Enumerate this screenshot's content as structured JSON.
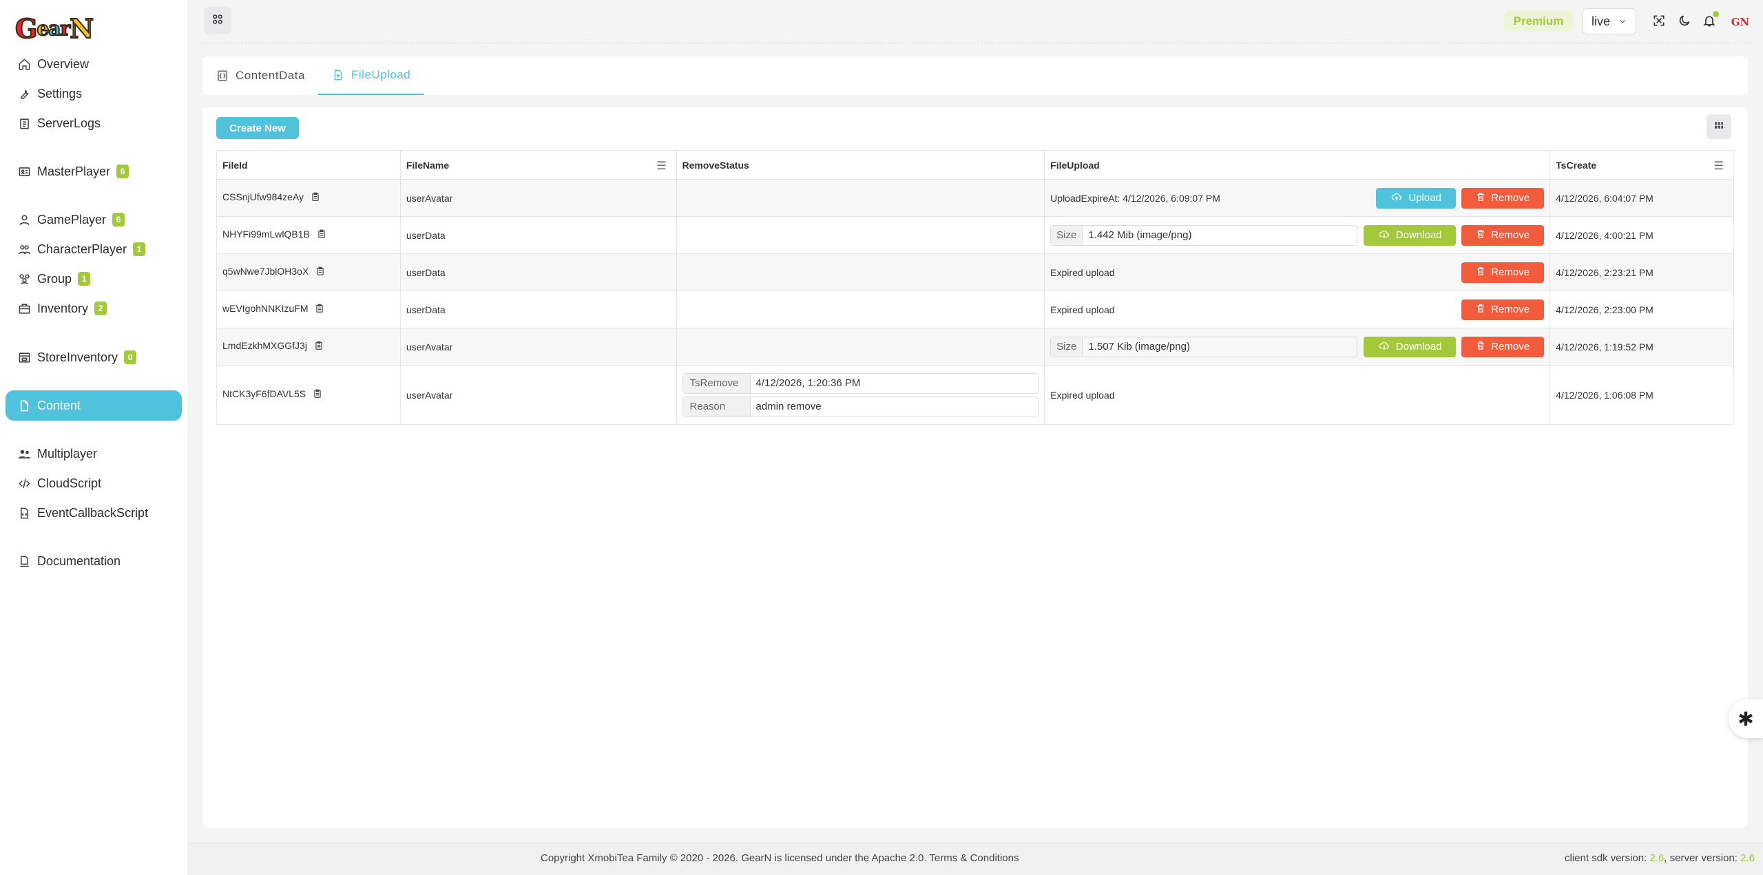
{
  "brand": {
    "logo_letters": [
      "G",
      "e",
      "a",
      "r",
      "N"
    ],
    "logo_colors": [
      "#e8232a",
      "#f7c21c",
      "#3dbde6",
      "#e8232a",
      "#f7c21c"
    ]
  },
  "sidebar": {
    "items": [
      {
        "label": "Overview",
        "icon": "home-icon"
      },
      {
        "label": "Settings",
        "icon": "wrench-icon"
      },
      {
        "label": "ServerLogs",
        "icon": "clipboard-icon"
      },
      {
        "label": "MasterPlayer",
        "icon": "id-card-icon",
        "badge": "6"
      },
      {
        "label": "GamePlayer",
        "icon": "user-icon",
        "badge": "6"
      },
      {
        "label": "CharacterPlayer",
        "icon": "users-icon",
        "badge": "1"
      },
      {
        "label": "Group",
        "icon": "group-icon",
        "badge": "1"
      },
      {
        "label": "Inventory",
        "icon": "briefcase-icon",
        "badge": "2"
      },
      {
        "label": "StoreInventory",
        "icon": "store-icon",
        "badge": "0"
      },
      {
        "label": "Content",
        "icon": "file-icon",
        "active": true
      },
      {
        "label": "Multiplayer",
        "icon": "people-icon"
      },
      {
        "label": "CloudScript",
        "icon": "code-icon"
      },
      {
        "label": "EventCallbackScript",
        "icon": "file-code-icon"
      },
      {
        "label": "Documentation",
        "icon": "doc-icon"
      }
    ]
  },
  "topbar": {
    "premium_label": "Premium",
    "environment": "live"
  },
  "tabs": [
    {
      "label": "ContentData",
      "icon": "bracket-file-icon"
    },
    {
      "label": "FileUpload",
      "icon": "upload-file-icon",
      "active": true
    }
  ],
  "toolbar": {
    "create_label": "Create New"
  },
  "table": {
    "columns": [
      "FileId",
      "FileName",
      "RemoveStatus",
      "FileUpload",
      "TsCreate"
    ],
    "rows": [
      {
        "file_id": "CSSnjUfw984zeAy",
        "file_name": "userAvatar",
        "upload_text": "UploadExpireAt: 4/12/2026, 6:09:07 PM",
        "ts_create": "4/12/2026, 6:04:07 PM"
      },
      {
        "file_id": "NHYFi99mLwlQB1B",
        "file_name": "userData",
        "size_label": "Size",
        "size_value": "1.442 Mib (image/png)",
        "ts_create": "4/12/2026, 4:00:21 PM"
      },
      {
        "file_id": "q5wNwe7JblOH3oX",
        "file_name": "userData",
        "upload_text": "Expired upload",
        "ts_create": "4/12/2026, 2:23:21 PM"
      },
      {
        "file_id": "wEVIgohNNKIzuFM",
        "file_name": "userData",
        "upload_text": "Expired upload",
        "ts_create": "4/12/2026, 2:23:00 PM"
      },
      {
        "file_id": "LmdEzkhMXGGfJ3j",
        "file_name": "userAvatar",
        "size_label": "Size",
        "size_value": "1.507 Kib (image/png)",
        "ts_create": "4/12/2026, 1:19:52 PM"
      },
      {
        "file_id": "NtCK3yF6fDAVL5S",
        "file_name": "userAvatar",
        "ts_remove_label": "TsRemove",
        "ts_remove_value": "4/12/2026, 1:20:36 PM",
        "reason_label": "Reason",
        "reason_value": "admin remove",
        "upload_text": "Expired upload",
        "ts_create": "4/12/2026, 1:06:08 PM"
      }
    ],
    "buttons": {
      "upload": "Upload",
      "download": "Download",
      "remove": "Remove"
    }
  },
  "footer": {
    "copyright": "Copyright XmobiTea Family © 2020 - 2026. GearN is licensed under the Apache 2.0. Terms & Conditions",
    "client_label": "client sdk version: ",
    "client_version": "2.6",
    "server_label": ", server version: ",
    "server_version": "2.6"
  },
  "colors": {
    "accent": "#4ec3db",
    "green": "#a3c93a",
    "danger": "#f25c3d"
  }
}
